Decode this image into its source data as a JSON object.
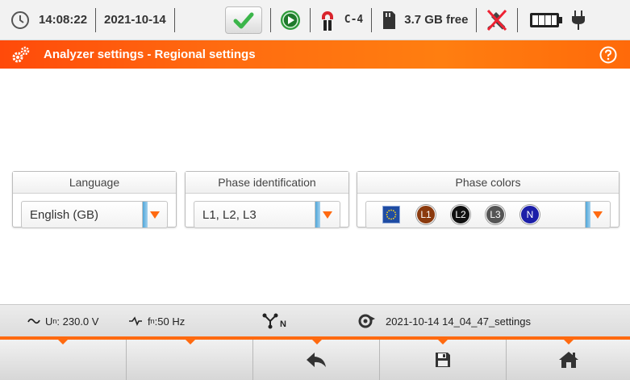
{
  "status": {
    "time": "14:08:22",
    "date": "2021-10-14",
    "clamp_type": "C-4",
    "storage_free": "3.7 GB free"
  },
  "title": {
    "text": "Analyzer settings - Regional settings"
  },
  "language": {
    "header": "Language",
    "selected": "English (GB)"
  },
  "phase_identification": {
    "header": "Phase identification",
    "selected": "L1, L2, L3"
  },
  "phase_colors": {
    "header": "Phase colors",
    "phases": [
      {
        "label": "L1",
        "color": "#8b3a0e"
      },
      {
        "label": "L2",
        "color": "#111111"
      },
      {
        "label": "L3",
        "color": "#555555"
      },
      {
        "label": "N",
        "color": "#1c1fa8"
      }
    ]
  },
  "info": {
    "voltage_prefix": "U",
    "voltage_sub": "n",
    "voltage_value": ": 230.0 V",
    "freq_prefix": "f",
    "freq_sub": "n",
    "freq_value": ":50 Hz",
    "system_icon_label": "N",
    "settings_file": "2021-10-14 14_04_47_settings"
  },
  "colors": {
    "accent": "#ff6a10",
    "ok_green": "#3bb54a",
    "play_green": "#2e9b3a"
  },
  "buttons": [
    {
      "icon": "blank"
    },
    {
      "icon": "blank"
    },
    {
      "icon": "back-arrow-icon"
    },
    {
      "icon": "save-icon"
    },
    {
      "icon": "home-icon"
    }
  ]
}
